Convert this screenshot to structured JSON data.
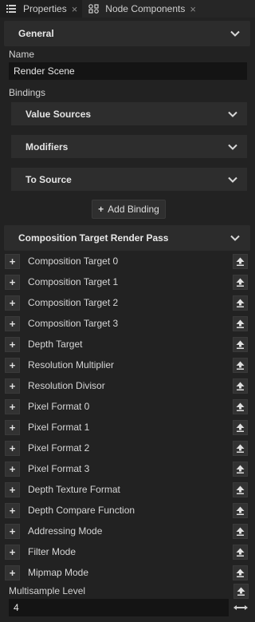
{
  "tabs": [
    {
      "label": "Properties",
      "icon": "list-icon",
      "active": true
    },
    {
      "label": "Node Components",
      "icon": "node-components-icon",
      "active": false
    }
  ],
  "general": {
    "title": "General",
    "name_label": "Name",
    "name_value": "Render Scene",
    "bindings_label": "Bindings",
    "bindings": [
      "Value Sources",
      "Modifiers",
      "To Source"
    ],
    "add_binding": "Add Binding"
  },
  "composition": {
    "title": "Composition Target Render Pass",
    "properties": [
      "Composition Target 0",
      "Composition Target 1",
      "Composition Target 2",
      "Composition Target 3",
      "Depth Target",
      "Resolution Multiplier",
      "Resolution Divisor",
      "Pixel Format 0",
      "Pixel Format 1",
      "Pixel Format 2",
      "Pixel Format 3",
      "Depth Texture Format",
      "Depth Compare Function",
      "Addressing Mode",
      "Filter Mode",
      "Mipmap Mode"
    ],
    "multisample_label": "Multisample Level",
    "multisample_value": "4"
  },
  "colors": {
    "background": "#222222",
    "header": "#2c2c2c",
    "input": "#141414"
  }
}
